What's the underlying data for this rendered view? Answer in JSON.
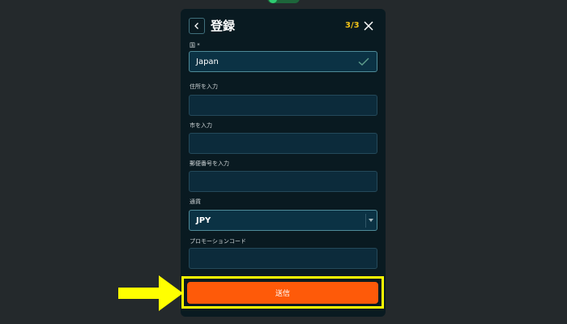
{
  "colors": {
    "page_bg": "#24292c",
    "modal_bg": "#091a21",
    "field_bg": "#0c2b3b",
    "step_color": "#f2c318",
    "submit_bg": "#fe5a09",
    "highlight": "#ffff00"
  },
  "header": {
    "title": "登録",
    "step": "3/3",
    "back_icon": "chevron-left-icon",
    "close_icon": "close-icon"
  },
  "form": {
    "country": {
      "label": "国 *",
      "value": "Japan",
      "icon": "check-icon"
    },
    "address": {
      "label": "住所を入力",
      "value": ""
    },
    "city": {
      "label": "市を入力",
      "value": ""
    },
    "postal": {
      "label": "郵便番号を入力",
      "value": ""
    },
    "currency": {
      "label": "通貨",
      "value": "JPY",
      "icon": "chevron-down-icon"
    },
    "promo": {
      "label": "プロモーションコード",
      "value": ""
    }
  },
  "submit": {
    "label": "送信"
  },
  "annotation": {
    "icon": "arrow-right-icon"
  }
}
